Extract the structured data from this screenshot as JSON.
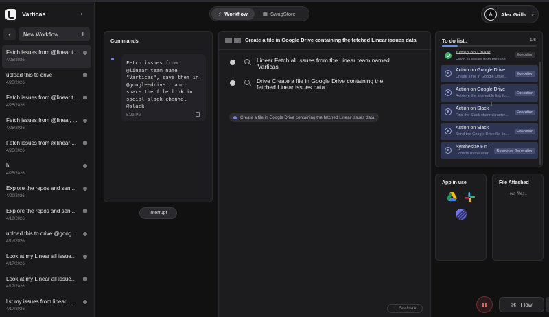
{
  "brand": {
    "name": "Varticas"
  },
  "sidebar": {
    "new_workflow_label": "New Workflow",
    "chats": [
      {
        "title": "Fetch issues from @linear t...",
        "date": "4/25/2026",
        "active": true,
        "icon": "dot-icon"
      },
      {
        "title": "upload this to drive",
        "date": "4/25/2026",
        "active": false,
        "icon": "envelope-icon"
      },
      {
        "title": "Fetch issues from @linear t...",
        "date": "4/25/2026",
        "active": false,
        "icon": "envelope-icon"
      },
      {
        "title": "Fetch issues from @linear, ...",
        "date": "4/25/2026",
        "active": false,
        "icon": "dot-icon"
      },
      {
        "title": "Fetch issues from @linear ...",
        "date": "4/25/2026",
        "active": false,
        "icon": "envelope-icon"
      },
      {
        "title": "hi",
        "date": "4/25/2026",
        "active": false,
        "icon": "dot-icon"
      },
      {
        "title": "Explore the repos and sen...",
        "date": "4/20/2026",
        "active": false,
        "icon": "dot-icon"
      },
      {
        "title": "Explore the repos and sen...",
        "date": "4/18/2026",
        "active": false,
        "icon": "envelope-icon"
      },
      {
        "title": "upload this to drive @goog...",
        "date": "4/17/2026",
        "active": false,
        "icon": "dot-icon"
      },
      {
        "title": "Look at my Linear all issue...",
        "date": "4/17/2026",
        "active": false,
        "icon": "dot-icon"
      },
      {
        "title": "Look at my Linear all issue...",
        "date": "4/17/2026",
        "active": false,
        "icon": "envelope-icon"
      },
      {
        "title": "list my issues from linear ...",
        "date": "4/17/2026",
        "active": false,
        "icon": "dot-icon"
      }
    ]
  },
  "header": {
    "tabs": [
      {
        "label": "Workflow",
        "active": true,
        "icon": "lightning-icon"
      },
      {
        "label": "SwagStore",
        "active": false,
        "icon": "grid-icon"
      }
    ],
    "profile": {
      "initial": "A",
      "name": "Alex Grills"
    }
  },
  "commands": {
    "title": "Commands",
    "text": "Fetch issues from @linear team name \"Varticas\", save them in @google-drive , and share the file link in social slack channel @slack",
    "time": "5:23 PM",
    "interrupt_label": "Interrupt"
  },
  "main": {
    "title": "Create a file in Google Drive containing the fetched Linear issues data",
    "steps": [
      {
        "text": "Linear Fetch all issues from the Linear team named 'Varticas'"
      },
      {
        "text": "Drive Create a file in Google Drive containing the fetched Linear issues data"
      }
    ],
    "chip": "Create a file in Google Drive containing the fetched Linear issues data",
    "feedback_label": "Feedback"
  },
  "todo": {
    "title": "To do list..",
    "count": "1/6",
    "progress": 0.17,
    "items": [
      {
        "name": "Action on Linear",
        "sub": "Fetch all issues from the Line...",
        "tag": "Execution",
        "done": true
      },
      {
        "name": "Action on Google Drive",
        "sub": "Create a file in Google Drive...",
        "tag": "Execution",
        "done": false
      },
      {
        "name": "Action on Google Drive",
        "sub": "Retrieve the shareable link fo...",
        "tag": "Execution",
        "done": false
      },
      {
        "name": "Action on Slack",
        "sub": "Find the Slack channel name...",
        "tag": "Execution",
        "done": false
      },
      {
        "name": "Action on Slack",
        "sub": "Send the Google Drive file lin...",
        "tag": "Execution",
        "done": false
      },
      {
        "name": "Synthesize Fin...",
        "sub": "Confirm to the user...",
        "tag": "Response Generation",
        "done": false
      }
    ]
  },
  "apps": {
    "title": "App in use",
    "icons": [
      "google-drive-icon",
      "slack-icon",
      "linear-icon"
    ]
  },
  "files": {
    "title": "File Attached",
    "empty_text": "No files.."
  },
  "footer": {
    "flow_label": "Flow"
  },
  "colors": {
    "accent": "#7c7cf0",
    "todo_active_bg": "#2e3552",
    "done_green": "#3bb56b",
    "stop_red": "#ff5555"
  }
}
